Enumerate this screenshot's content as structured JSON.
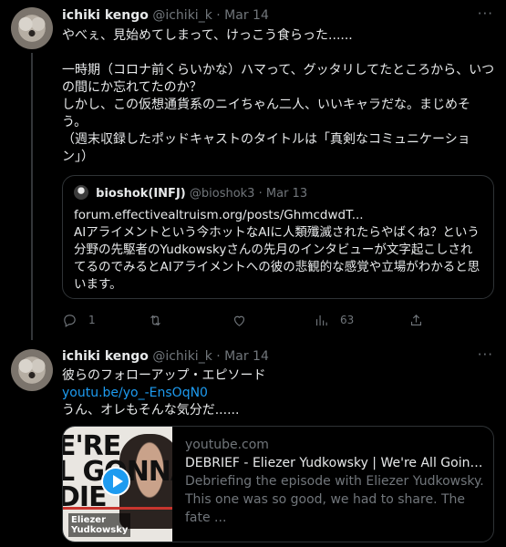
{
  "tweets": [
    {
      "author": {
        "name": "ichiki kengo",
        "handle": "@ichiki_k",
        "date": "Mar 14"
      },
      "more": "···",
      "text": "やべぇ、見始めてしまって、けっこう食らった......\n\n一時期（コロナ前くらいかな）ハマって、グッタリしてたところから、いつの間にか忘れてたのか？\nしかし、この仮想通貨系のニイちゃん二人、いいキャラだな。まじめそう。\n（週末収録したポッドキャストのタイトルは「真剣なコミュニケーション」）",
      "quote": {
        "name": "bioshok(INFJ)",
        "handle": "@bioshok3",
        "date": "Mar 13",
        "text": "forum.effectivealtruism.org/posts/GhmcdwdT...\nAIアライメントという今ホットなAIに人類殲滅されたらやばくね？という分野の先駆者のYudkowskyさんの先月のインタビューが文字起こしされてるのでみるとAIアライメントへの彼の悲観的な感覚や立場がわかると思います。"
      },
      "actions": {
        "replies": "1",
        "retweets": "",
        "likes": "",
        "views": "63"
      }
    },
    {
      "author": {
        "name": "ichiki kengo",
        "handle": "@ichiki_k",
        "date": "Mar 14"
      },
      "more": "···",
      "line1": "彼らのフォローアップ・エピソード",
      "link": "youtu.be/yo_-EnsOqN0",
      "line3": "うん、オレもそんな気分だ......",
      "card": {
        "thumb_text": "E'RE\nL GONNA\nDIE",
        "thumb_caption": "Eliezer\nYudkowsky",
        "domain": "youtube.com",
        "title": "DEBRIEF - Eliezer Yudkowsky | We're All Going to ...",
        "description": "Debriefing the episode with Eliezer Yudkowsky. This one was so good, we had to share. The fate ..."
      }
    }
  ],
  "colors": {
    "background": "#000000",
    "text": "#e7e9ea",
    "muted": "#71767b",
    "link": "#1d9bf0"
  }
}
